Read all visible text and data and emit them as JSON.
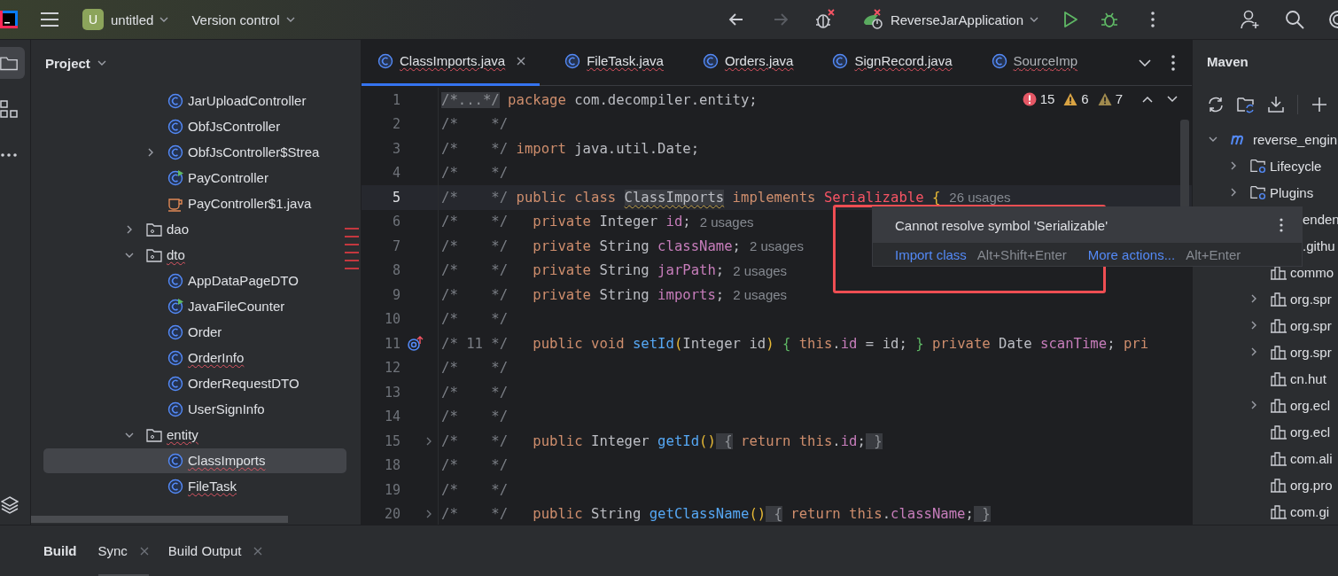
{
  "toolbar": {
    "project_badge": "U",
    "project": "untitled",
    "vcs": "Version control",
    "run_config": "ReverseJarApplication"
  },
  "left_strip": [
    {
      "kind": "folder",
      "selected": true
    },
    {
      "kind": "structure",
      "selected": false
    },
    {
      "kind": "more",
      "selected": false
    }
  ],
  "project": {
    "title": "Project",
    "tree": [
      {
        "kind": "group",
        "children": [
          {
            "label": "JarUploadController",
            "kind": "class",
            "selected": false,
            "warning": false
          },
          {
            "label": "ObfJsController",
            "kind": "class",
            "selected": false,
            "warning": false
          },
          {
            "label": "ObfJsController$Strea",
            "kind": "class",
            "selected": false,
            "warning": false,
            "expanded": false
          },
          {
            "label": "PayController",
            "kind": "runnable",
            "selected": false,
            "warning": false
          },
          {
            "label": "PayController$1.java",
            "kind": "javafile",
            "selected": false,
            "warning": false
          }
        ]
      },
      {
        "label": "dao",
        "kind": "package",
        "selected": false,
        "warning": false,
        "expanded": false
      },
      {
        "label": "dto",
        "kind": "package",
        "selected": false,
        "warning": true,
        "expanded": true,
        "children": [
          {
            "label": "AppDataPageDTO",
            "kind": "class",
            "selected": false,
            "warning": false
          },
          {
            "label": "JavaFileCounter",
            "kind": "runnable",
            "selected": false,
            "warning": false
          },
          {
            "label": "Order",
            "kind": "class",
            "selected": false,
            "warning": false
          },
          {
            "label": "OrderInfo",
            "kind": "class",
            "selected": false,
            "warning": true
          },
          {
            "label": "OrderRequestDTO",
            "kind": "class",
            "selected": false,
            "warning": false
          },
          {
            "label": "UserSignInfo",
            "kind": "class",
            "selected": false,
            "warning": false
          }
        ]
      },
      {
        "label": "entity",
        "kind": "package",
        "selected": false,
        "warning": true,
        "expanded": true,
        "children": [
          {
            "label": "ClassImports",
            "kind": "class",
            "selected": true,
            "warning": true
          },
          {
            "label": "FileTask",
            "kind": "class",
            "selected": false,
            "warning": true
          }
        ]
      }
    ]
  },
  "tabs": [
    {
      "label": "ClassImports.java",
      "selected": true,
      "warning": true
    },
    {
      "label": "FileTask.java",
      "selected": false,
      "warning": true
    },
    {
      "label": "Orders.java",
      "selected": false,
      "warning": true
    },
    {
      "label": "SignRecord.java",
      "selected": false,
      "warning": true
    },
    {
      "label": "SourceImp",
      "selected": false,
      "warning": true
    }
  ],
  "inspections": {
    "errors": "15",
    "warnings": "6",
    "weak_warnings": "7"
  },
  "code": [
    {
      "num": "1",
      "current": false,
      "tokens": [
        {
          "kind": "fold",
          "s": "/*...*/"
        },
        {
          "kind": "kw",
          "s": " package"
        },
        {
          "kind": "t",
          "s": " com.decompiler.entity;"
        }
      ]
    },
    {
      "num": "2",
      "current": false,
      "tokens": [
        {
          "kind": "c",
          "s": "/*    */"
        }
      ]
    },
    {
      "num": "3",
      "current": false,
      "tokens": [
        {
          "kind": "c",
          "s": "/*    */"
        },
        {
          "kind": "kw",
          "s": " import"
        },
        {
          "kind": "t",
          "s": " java.util.Date;"
        }
      ]
    },
    {
      "num": "4",
      "current": false,
      "tokens": [
        {
          "kind": "c",
          "s": "/*    */"
        }
      ]
    },
    {
      "num": "5",
      "current": true,
      "tokens": [
        {
          "kind": "c",
          "s": "/*    */"
        },
        {
          "kind": "kw",
          "s": " public class "
        },
        {
          "kind": "decl",
          "s": "ClassImports"
        },
        {
          "kind": "kw",
          "s": " implements "
        },
        {
          "kind": "err",
          "s": "Serializable "
        },
        {
          "kind": "p",
          "s": "{"
        },
        {
          "kind": "h",
          "s": "26 usages"
        }
      ]
    },
    {
      "num": "6",
      "current": false,
      "tokens": [
        {
          "kind": "c",
          "s": "/*    */"
        },
        {
          "kind": "kw",
          "s": "   private"
        },
        {
          "kind": "t",
          "s": " Integer "
        },
        {
          "kind": "f",
          "s": "id"
        },
        {
          "kind": "t",
          "s": ";"
        },
        {
          "kind": "h",
          "s": "2 usages"
        }
      ]
    },
    {
      "num": "7",
      "current": false,
      "tokens": [
        {
          "kind": "c",
          "s": "/*    */"
        },
        {
          "kind": "kw",
          "s": "   private"
        },
        {
          "kind": "t",
          "s": " String "
        },
        {
          "kind": "f",
          "s": "className"
        },
        {
          "kind": "t",
          "s": ";"
        },
        {
          "kind": "h",
          "s": "2 usages"
        }
      ]
    },
    {
      "num": "8",
      "current": false,
      "tokens": [
        {
          "kind": "c",
          "s": "/*    */"
        },
        {
          "kind": "kw",
          "s": "   private"
        },
        {
          "kind": "t",
          "s": " String "
        },
        {
          "kind": "f",
          "s": "jarPath"
        },
        {
          "kind": "t",
          "s": ";"
        },
        {
          "kind": "h",
          "s": "2 usages"
        }
      ]
    },
    {
      "num": "9",
      "current": false,
      "tokens": [
        {
          "kind": "c",
          "s": "/*    */"
        },
        {
          "kind": "kw",
          "s": "   private"
        },
        {
          "kind": "t",
          "s": " String "
        },
        {
          "kind": "f",
          "s": "imports"
        },
        {
          "kind": "t",
          "s": ";"
        },
        {
          "kind": "h",
          "s": "2 usages"
        }
      ]
    },
    {
      "num": "10",
      "current": false,
      "tokens": [
        {
          "kind": "c",
          "s": "/*    */"
        }
      ]
    },
    {
      "num": "11",
      "current": false,
      "gutter": {
        "kind": "override"
      },
      "tokens": [
        {
          "kind": "c",
          "s": "/* 11 */"
        },
        {
          "kind": "kw",
          "s": "   public void "
        },
        {
          "kind": "m",
          "s": "setId"
        },
        {
          "kind": "p",
          "s": "("
        },
        {
          "kind": "t",
          "s": "Integer id"
        },
        {
          "kind": "p",
          "s": ")"
        },
        {
          "kind": "b",
          "s": " { "
        },
        {
          "kind": "kw",
          "s": "this"
        },
        {
          "kind": "t",
          "s": "."
        },
        {
          "kind": "f",
          "s": "id"
        },
        {
          "kind": "t",
          "s": " = id; "
        },
        {
          "kind": "b",
          "s": "} "
        },
        {
          "kind": "kw",
          "s": "private"
        },
        {
          "kind": "t",
          "s": " Date "
        },
        {
          "kind": "f",
          "s": "scanTime"
        },
        {
          "kind": "t",
          "s": "; "
        },
        {
          "kind": "kw",
          "s": "pri"
        }
      ]
    },
    {
      "num": "12",
      "current": false,
      "tokens": [
        {
          "kind": "c",
          "s": "/*    */"
        }
      ]
    },
    {
      "num": "13",
      "current": false,
      "tokens": [
        {
          "kind": "c",
          "s": "/*    */"
        }
      ]
    },
    {
      "num": "14",
      "current": false,
      "tokens": [
        {
          "kind": "c",
          "s": "/*    */"
        }
      ]
    },
    {
      "num": "15",
      "current": false,
      "gutter": {
        "kind": "fold"
      },
      "tokens": [
        {
          "kind": "c",
          "s": "/*    */"
        },
        {
          "kind": "kw",
          "s": "   public"
        },
        {
          "kind": "t",
          "s": " Integer "
        },
        {
          "kind": "m",
          "s": "getId"
        },
        {
          "kind": "p",
          "s": "()"
        },
        {
          "kind": "fold",
          "s": " {"
        },
        {
          "kind": "kw",
          "s": " return this"
        },
        {
          "kind": "t",
          "s": "."
        },
        {
          "kind": "f",
          "s": "id"
        },
        {
          "kind": "t",
          "s": ";"
        },
        {
          "kind": "fold",
          "s": " }"
        }
      ]
    },
    {
      "num": "18",
      "current": false,
      "tokens": [
        {
          "kind": "c",
          "s": "/*    */"
        }
      ]
    },
    {
      "num": "19",
      "current": false,
      "tokens": [
        {
          "kind": "c",
          "s": "/*    */"
        }
      ]
    },
    {
      "num": "20",
      "current": false,
      "gutter": {
        "kind": "fold"
      },
      "tokens": [
        {
          "kind": "c",
          "s": "/*    */"
        },
        {
          "kind": "kw",
          "s": "   public"
        },
        {
          "kind": "t",
          "s": " String "
        },
        {
          "kind": "m",
          "s": "getClassName"
        },
        {
          "kind": "p",
          "s": "()"
        },
        {
          "kind": "fold",
          "s": " {"
        },
        {
          "kind": "kw",
          "s": " return this"
        },
        {
          "kind": "t",
          "s": "."
        },
        {
          "kind": "f",
          "s": "className"
        },
        {
          "kind": "t",
          "s": ";"
        },
        {
          "kind": "fold",
          "s": " }"
        }
      ]
    }
  ],
  "popup": {
    "message": "Cannot resolve symbol 'Serializable'",
    "actions": [
      {
        "label": "Import class",
        "shortcut": "Alt+Shift+Enter"
      },
      {
        "label": "More actions...",
        "shortcut": "Alt+Enter"
      }
    ]
  },
  "maven": {
    "title": "Maven",
    "tree": [
      {
        "label": "reverse_engin",
        "kind": "module",
        "expanded": true,
        "children": [
          {
            "label": "Lifecycle",
            "kind": "folder",
            "expanded": false
          },
          {
            "label": "Plugins",
            "kind": "folder",
            "expanded": false
          },
          {
            "label": "enden",
            "kind": "partial",
            "children": [
              {
                "label": ".githu",
                "kind": "partial"
              },
              {
                "label": "commo",
                "kind": "library"
              },
              {
                "label": "org.spr",
                "kind": "library",
                "expanded": false
              },
              {
                "label": "org.spr",
                "kind": "library",
                "expanded": false
              },
              {
                "label": "org.spr",
                "kind": "library",
                "expanded": false
              },
              {
                "label": "cn.hut",
                "kind": "library"
              },
              {
                "label": "org.ecl",
                "kind": "library",
                "expanded": false
              },
              {
                "label": "org.ecl",
                "kind": "library"
              },
              {
                "label": "com.ali",
                "kind": "library"
              },
              {
                "label": "org.pro",
                "kind": "library"
              },
              {
                "label": "com.gi",
                "kind": "library"
              }
            ]
          }
        ]
      }
    ]
  },
  "bottom": {
    "title": "Build",
    "tabs": [
      {
        "label": "Sync",
        "selected": true
      },
      {
        "label": "Build Output",
        "selected": false
      }
    ]
  }
}
